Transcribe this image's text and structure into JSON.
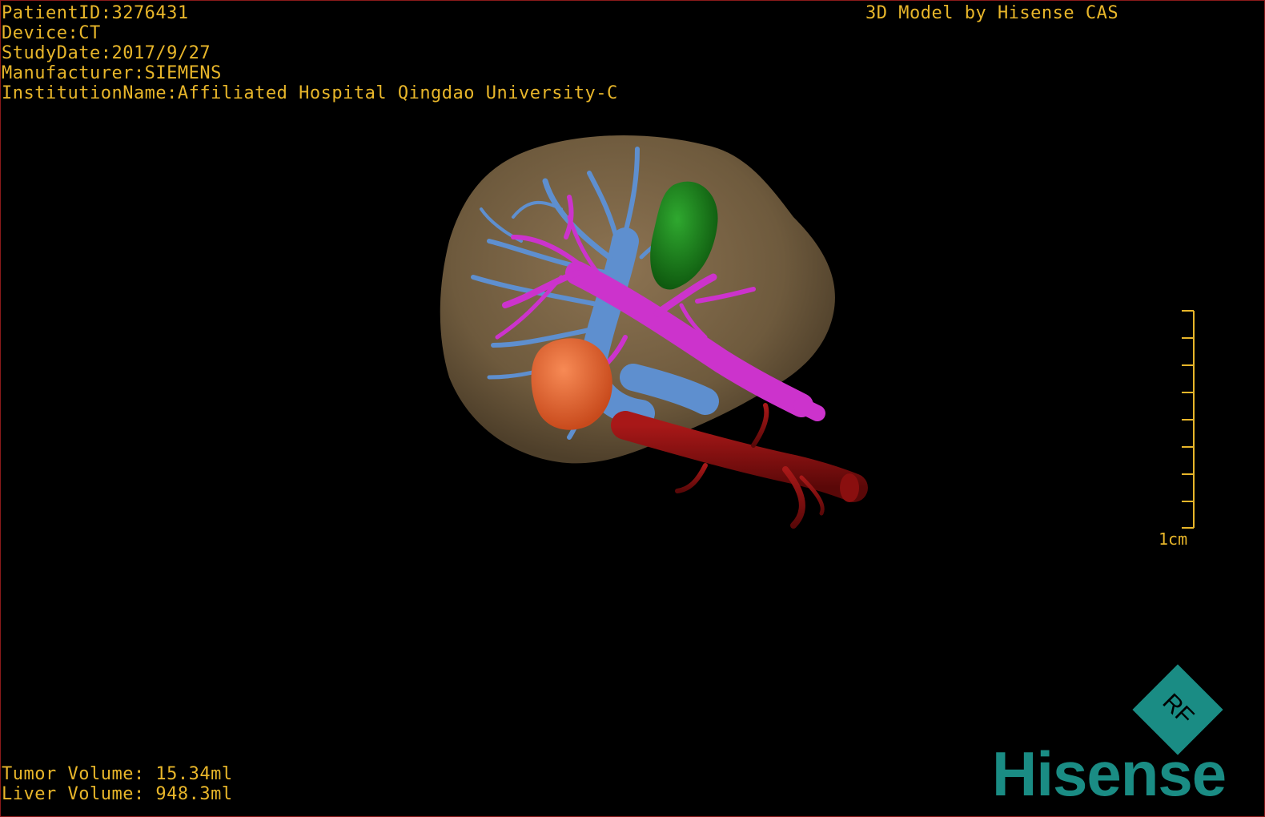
{
  "info": {
    "patient_id": "PatientID:3276431",
    "device": "Device:CT",
    "study_date": "StudyDate:2017/9/27",
    "manufacturer": "Manufacturer:SIEMENS",
    "institution": "InstitutionName:Affiliated Hospital Qingdao University-C"
  },
  "header_right": {
    "model_credit": "3D Model by Hisense CAS"
  },
  "measurements": {
    "tumor_volume": "Tumor Volume: 15.34ml",
    "liver_volume": "Liver Volume: 948.3ml"
  },
  "scale_bar": {
    "label": "1cm",
    "ticks": 9
  },
  "logo": {
    "brand": "Hisense",
    "badge": "RF"
  },
  "colors": {
    "overlay_text": "#e8b62a",
    "liver": "#7a6344",
    "hepatic_vein": "#5e8fcf",
    "portal_vein": "#cc33cc",
    "gallbladder": "#1f8a1f",
    "tumor": "#e6622e",
    "artery": "#8a0f0f",
    "logo": "#1a8c84"
  },
  "structures": [
    "liver",
    "hepatic-vein",
    "portal-vein",
    "gallbladder",
    "tumor",
    "vena-cava"
  ]
}
